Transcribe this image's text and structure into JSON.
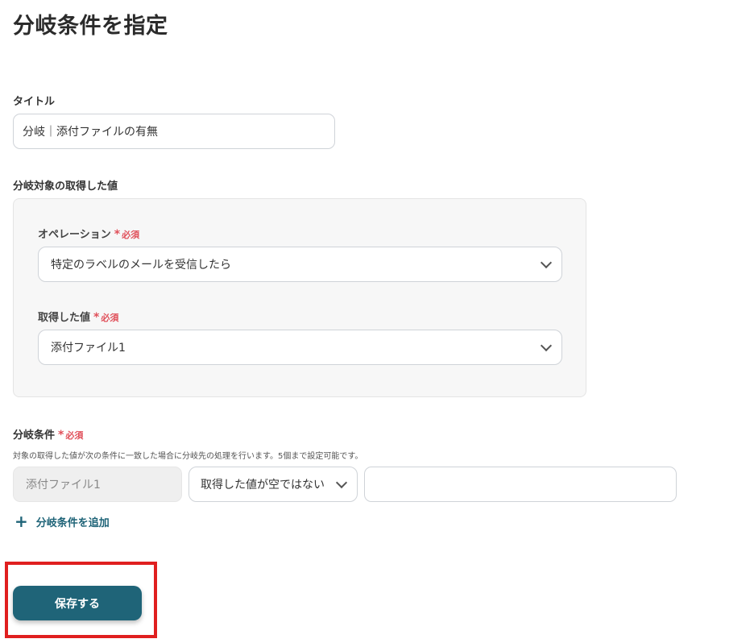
{
  "page": {
    "title": "分岐条件を指定"
  },
  "title_field": {
    "label": "タイトル",
    "value": "分岐｜添付ファイルの有無"
  },
  "target_section": {
    "label": "分岐対象の取得した値",
    "operation": {
      "label": "オペレーション",
      "required": "必須",
      "value": "特定のラベルのメールを受信したら"
    },
    "acquired": {
      "label": "取得した値",
      "required": "必須",
      "value": "添付ファイル1"
    }
  },
  "conditions": {
    "label": "分岐条件",
    "required": "必須",
    "description": "対象の取得した値が次の条件に一致した場合に分岐先の処理を行います。5個まで設定可能です。",
    "row": {
      "field": "添付ファイル1",
      "operator": "取得した値が空ではない",
      "value": ""
    },
    "add_label": "分岐条件を追加"
  },
  "actions": {
    "save_label": "保存する"
  },
  "colors": {
    "primary": "#1f6478",
    "required": "#e0505a",
    "highlight": "#e01f1f"
  }
}
